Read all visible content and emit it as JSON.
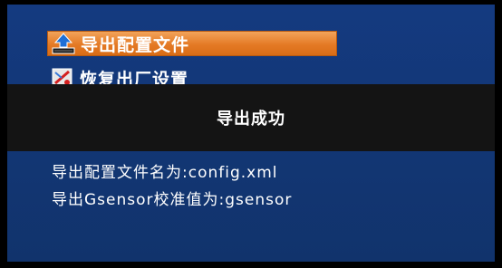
{
  "menu": {
    "items": [
      {
        "label": "导出配置文件",
        "icon": "export-icon",
        "selected": true
      },
      {
        "label": "恢复出厂设置",
        "icon": "factory-reset-icon",
        "selected": false
      }
    ]
  },
  "dialog": {
    "message": "导出成功"
  },
  "info": {
    "line1": "导出配置文件名为:config.xml",
    "line2": "导出Gsensor校准值为:gsensor"
  },
  "colors": {
    "panel_background": "#133874",
    "selection_highlight": "#e47a25",
    "dialog_background": "#141414",
    "text": "#ffffff"
  }
}
